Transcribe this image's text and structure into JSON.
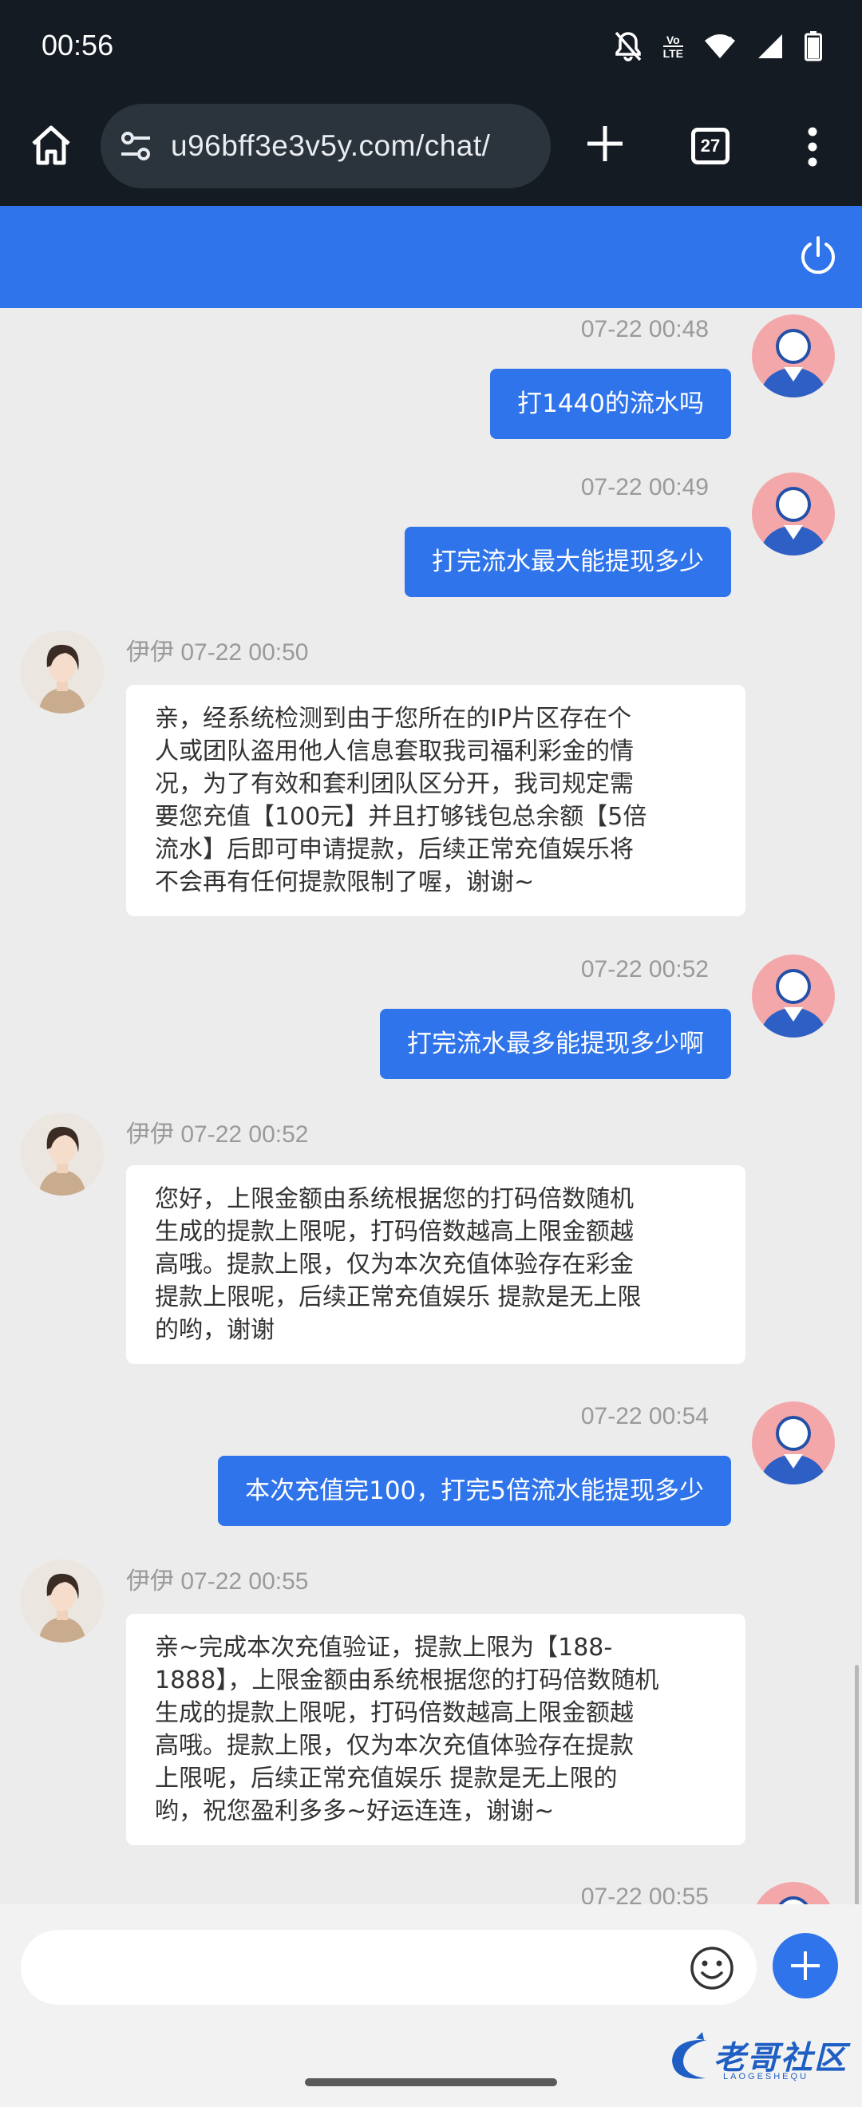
{
  "status_bar": {
    "time": "00:56",
    "icons": [
      "notifications-off-icon",
      "volte-icon",
      "wifi-icon",
      "signal-icon",
      "battery-icon"
    ],
    "volte_top": "Vo",
    "volte_bottom": "LTE"
  },
  "browser": {
    "url": "u96bff3e3v5y.com/chat/",
    "tab_count": "27"
  },
  "chat": {
    "messages": [
      {
        "sender": "user",
        "time": "07-22 00:48",
        "text": "打1440的流水吗"
      },
      {
        "sender": "user",
        "time": "07-22 00:49",
        "text": "打完流水最大能提现多少"
      },
      {
        "sender": "agent",
        "name": "伊伊",
        "time": "07-22 00:50",
        "lines": [
          "亲，经系统检测到由于您所在的IP片区存在个",
          "人或团队盗用他人信息套取我司福利彩金的情",
          "况，为了有效和套利团队区分开，我司规定需",
          "要您充值【100元】并且打够钱包总余额【5倍",
          "流水】后即可申请提款，后续正常充值娱乐将",
          "不会再有任何提款限制了喔，谢谢~"
        ]
      },
      {
        "sender": "user",
        "time": "07-22 00:52",
        "text": "打完流水最多能提现多少啊"
      },
      {
        "sender": "agent",
        "name": "伊伊",
        "time": "07-22 00:52",
        "lines": [
          "您好，上限金额由系统根据您的打码倍数随机",
          "生成的提款上限呢，打码倍数越高上限金额越",
          "高哦。提款上限，仅为本次充值体验存在彩金",
          "提款上限呢，后续正常充值娱乐 提款是无上限",
          "的哟，谢谢"
        ]
      },
      {
        "sender": "user",
        "time": "07-22 00:54",
        "text": "本次充值完100，打完5倍流水能提现多少"
      },
      {
        "sender": "agent",
        "name": "伊伊",
        "time": "07-22 00:55",
        "lines": [
          "亲~完成本次充值验证，提款上限为【188-",
          "1888】，上限金额由系统根据您的打码倍数随机",
          "生成的提款上限呢，打码倍数越高上限金额越",
          "高哦。提款上限，仅为本次充值体验存在提款",
          "上限呢，后续正常充值娱乐 提款是无上限的",
          "哟，祝您盈利多多~好运连连，谢谢~"
        ]
      },
      {
        "sender": "user",
        "time": "07-22 00:55",
        "text": ""
      }
    ]
  },
  "composer": {
    "placeholder": ""
  },
  "watermark": {
    "text": "老哥社区",
    "sub": "LAOGESHEQU"
  }
}
